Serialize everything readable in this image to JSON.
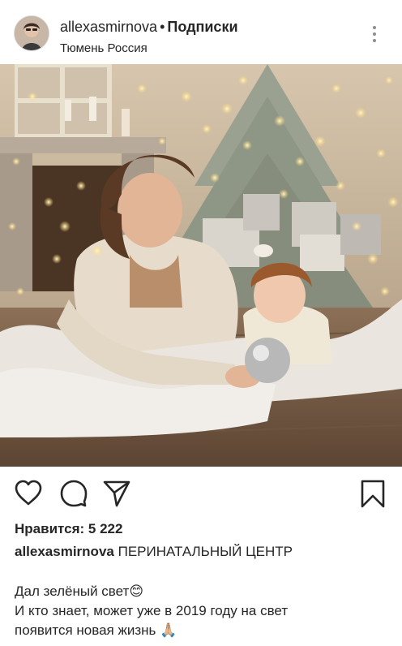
{
  "post": {
    "username": "allexasmirnova",
    "separator": "•",
    "follow_label": "Подписки",
    "location": "Тюмень Россия",
    "more_icon": "more-vertical-icon",
    "likes_label": "Нравится:",
    "likes_count": "5 222",
    "caption_username": "allexasmirnova",
    "caption_headline": "ПЕРИНАТАЛЬНЫЙ ЦЕНТР",
    "caption_lines": [
      "Дал зелёный свет😊",
      "И кто знает, может уже в 2019 году на свет",
      "появится новая жизнь 🙏🏼"
    ]
  },
  "actions": {
    "like_icon": "heart-icon",
    "comment_icon": "comment-icon",
    "share_icon": "send-icon",
    "save_icon": "bookmark-icon"
  },
  "colors": {
    "text": "#262626",
    "muted": "#8e8e8e",
    "background": "#ffffff"
  }
}
